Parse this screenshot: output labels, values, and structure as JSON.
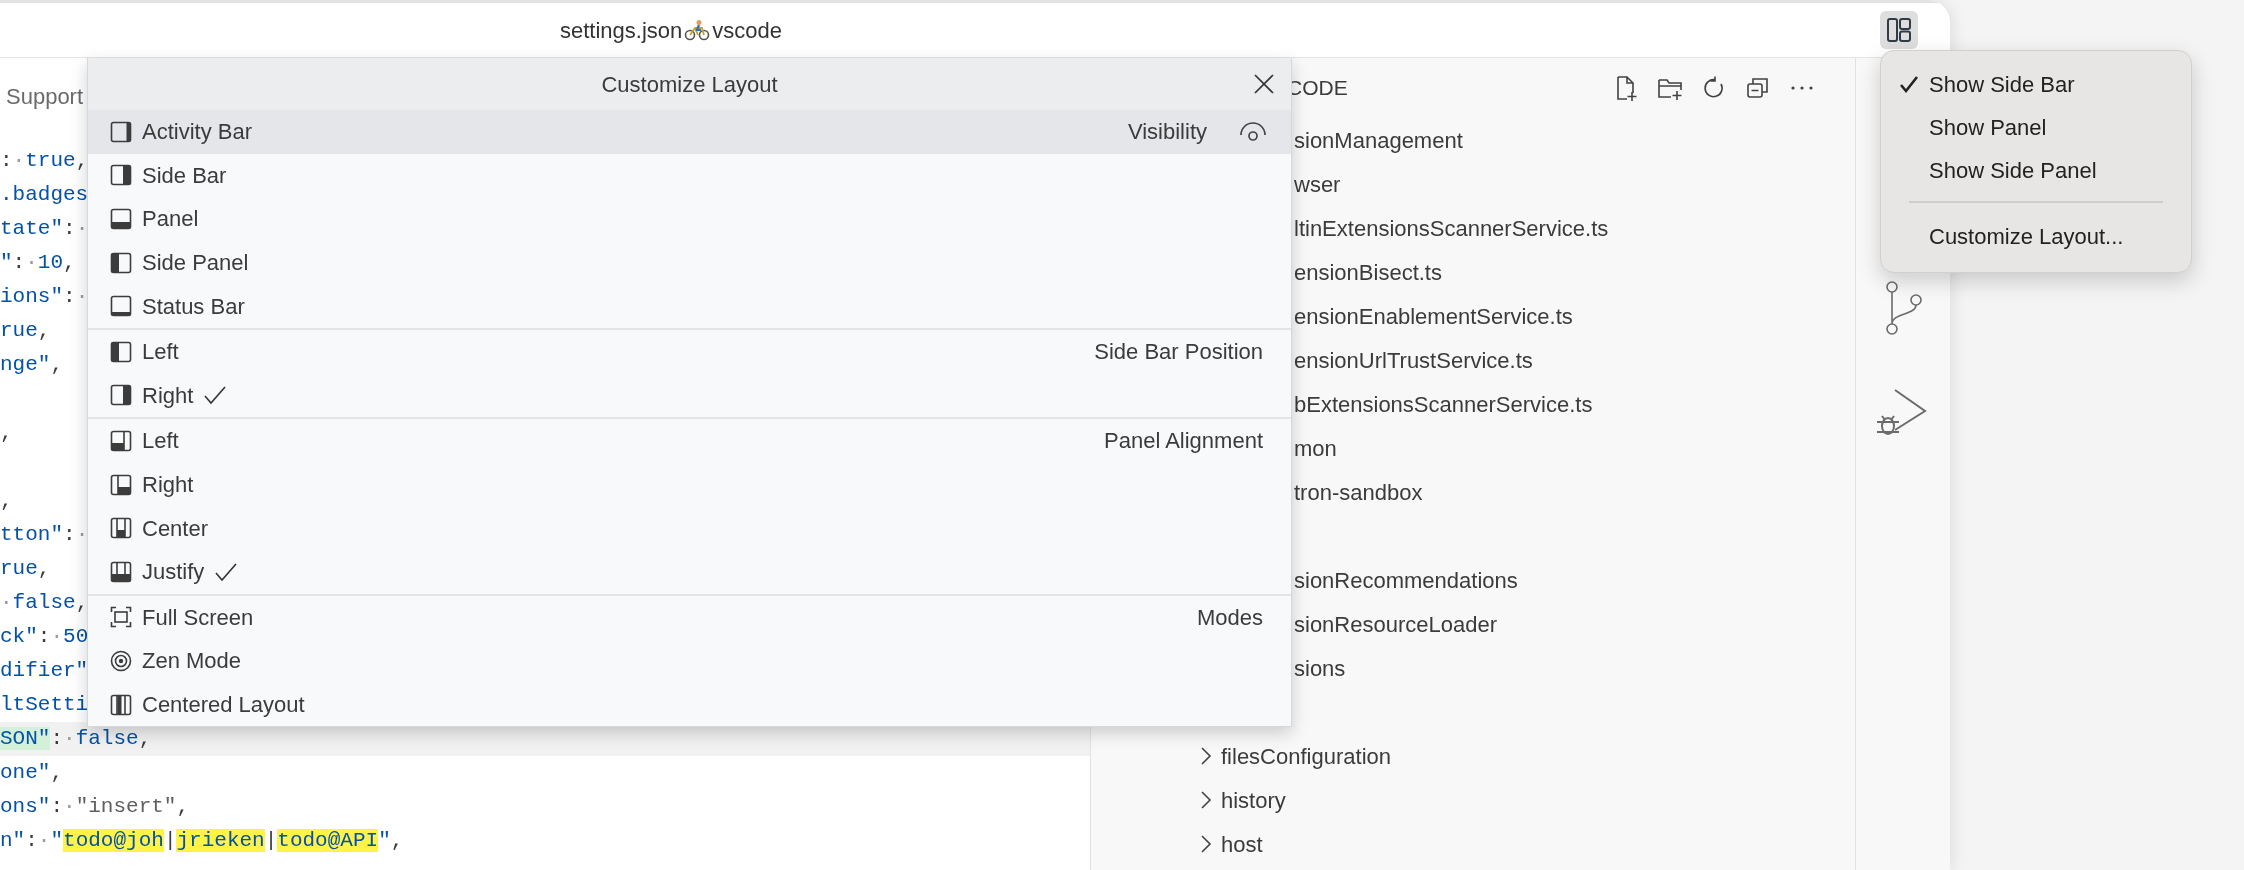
{
  "title_bar": {
    "file": "settings.json",
    "folder": "vscode"
  },
  "editor": {
    "tab": "Support",
    "lines": [
      {
        "current": false,
        "tokens": [
          {
            "kind": "punct",
            "text": ":"
          },
          {
            "kind": "ws",
            "text": "·"
          },
          {
            "kind": "lit",
            "text": "true"
          },
          {
            "kind": "punct",
            "text": ","
          }
        ]
      },
      {
        "current": false,
        "tokens": [
          {
            "kind": "key",
            "text": ".badges"
          }
        ]
      },
      {
        "current": false,
        "tokens": [
          {
            "kind": "key",
            "text": "tate\""
          },
          {
            "kind": "punct",
            "text": ":"
          },
          {
            "kind": "ws",
            "text": "·"
          }
        ]
      },
      {
        "current": false,
        "tokens": [
          {
            "kind": "key",
            "text": "\""
          },
          {
            "kind": "punct",
            "text": ":"
          },
          {
            "kind": "ws",
            "text": "·"
          },
          {
            "kind": "lit",
            "text": "10"
          },
          {
            "kind": "punct",
            "text": ","
          }
        ]
      },
      {
        "current": false,
        "tokens": [
          {
            "kind": "key",
            "text": "ions\""
          },
          {
            "kind": "punct",
            "text": ":"
          },
          {
            "kind": "ws",
            "text": "·"
          }
        ]
      },
      {
        "current": false,
        "tokens": [
          {
            "kind": "lit",
            "text": "rue"
          },
          {
            "kind": "punct",
            "text": ","
          }
        ]
      },
      {
        "current": false,
        "tokens": [
          {
            "kind": "lit",
            "text": "nge\""
          },
          {
            "kind": "punct",
            "text": ","
          }
        ]
      },
      {
        "current": false
      },
      {
        "current": false,
        "tokens": [
          {
            "kind": "punct",
            "text": ","
          }
        ]
      },
      {
        "current": false
      },
      {
        "current": false,
        "tokens": [
          {
            "kind": "punct",
            "text": ","
          }
        ]
      },
      {
        "current": false,
        "tokens": [
          {
            "kind": "key",
            "text": "tton\""
          },
          {
            "kind": "punct",
            "text": ":"
          },
          {
            "kind": "ws",
            "text": "·"
          }
        ]
      },
      {
        "current": false,
        "tokens": [
          {
            "kind": "lit",
            "text": "rue"
          },
          {
            "kind": "punct",
            "text": ","
          }
        ]
      },
      {
        "current": false,
        "tokens": [
          {
            "kind": "ws",
            "text": "·"
          },
          {
            "kind": "lit",
            "text": "false"
          },
          {
            "kind": "punct",
            "text": ","
          }
        ]
      },
      {
        "current": false,
        "tokens": [
          {
            "kind": "key",
            "text": "ck\""
          },
          {
            "kind": "punct",
            "text": ":"
          },
          {
            "kind": "ws",
            "text": "·"
          },
          {
            "kind": "lit",
            "text": "50"
          }
        ]
      },
      {
        "current": false,
        "tokens": [
          {
            "kind": "key",
            "text": "difier\""
          }
        ]
      },
      {
        "current": false,
        "tokens": [
          {
            "kind": "key",
            "text": "ltSetti"
          }
        ]
      },
      {
        "current": true,
        "tokens": [
          {
            "kind": "match",
            "text": "SON\""
          },
          {
            "kind": "punct",
            "text": ":"
          },
          {
            "kind": "ws",
            "text": "·"
          },
          {
            "kind": "lit",
            "text": "false"
          },
          {
            "kind": "punct",
            "text": ","
          }
        ]
      },
      {
        "current": false,
        "tokens": [
          {
            "kind": "lit",
            "text": "one\""
          },
          {
            "kind": "punct",
            "text": ","
          }
        ]
      },
      {
        "current": false,
        "tokens": [
          {
            "kind": "key",
            "text": "ons\""
          },
          {
            "kind": "punct",
            "text": ":"
          },
          {
            "kind": "ws",
            "text": "·"
          },
          {
            "kind": "str",
            "text": "\"insert\""
          },
          {
            "kind": "punct",
            "text": ","
          }
        ]
      },
      {
        "current": false,
        "tokens": [
          {
            "kind": "key",
            "text": "n\""
          },
          {
            "kind": "punct",
            "text": ":"
          },
          {
            "kind": "ws",
            "text": "·"
          },
          {
            "kind": "lit",
            "text": "\""
          },
          {
            "kind": "hl",
            "text": "todo@joh"
          },
          {
            "kind": "punct",
            "text": "|"
          },
          {
            "kind": "hl",
            "text": "jrieken"
          },
          {
            "kind": "punct",
            "text": "|"
          },
          {
            "kind": "hl",
            "text": "todo@API"
          },
          {
            "kind": "lit",
            "text": "\""
          },
          {
            "kind": "punct",
            "text": ","
          }
        ]
      }
    ]
  },
  "explorer": {
    "title": "CODE",
    "items": [
      {
        "kind": "cut",
        "label": "sionManagement"
      },
      {
        "kind": "cut",
        "label": "wser"
      },
      {
        "kind": "cut",
        "label": "ltinExtensionsScannerService.ts"
      },
      {
        "kind": "cut",
        "label": "ensionBisect.ts"
      },
      {
        "kind": "cut",
        "label": "ensionEnablementService.ts"
      },
      {
        "kind": "cut",
        "label": "ensionUrlTrustService.ts"
      },
      {
        "kind": "cut",
        "label": "bExtensionsScannerService.ts"
      },
      {
        "kind": "cut",
        "label": "mon"
      },
      {
        "kind": "cut",
        "label": "tron-sandbox"
      },
      {
        "kind": "covered"
      },
      {
        "kind": "cut",
        "label": "sionRecommendations"
      },
      {
        "kind": "cut",
        "label": "sionResourceLoader"
      },
      {
        "kind": "cut",
        "label": "sions"
      },
      {
        "kind": "covered"
      },
      {
        "kind": "folder",
        "label": "filesConfiguration",
        "expanded": false
      },
      {
        "kind": "folder",
        "label": "history",
        "expanded": false
      },
      {
        "kind": "folder",
        "label": "host",
        "expanded": false
      }
    ]
  },
  "customize_layout": {
    "title": "Customize Layout",
    "groups": [
      {
        "label": "Visibility",
        "items": [
          {
            "label": "Activity Bar",
            "selected": true
          },
          {
            "label": "Side Bar",
            "selected": false
          },
          {
            "label": "Panel",
            "selected": false
          },
          {
            "label": "Side Panel",
            "selected": false
          },
          {
            "label": "Status Bar",
            "selected": false
          }
        ]
      },
      {
        "label": "Side Bar Position",
        "items": [
          {
            "label": "Left",
            "selected": false,
            "checked": false
          },
          {
            "label": "Right",
            "selected": false,
            "checked": true
          }
        ]
      },
      {
        "label": "Panel Alignment",
        "items": [
          {
            "label": "Left",
            "selected": false,
            "checked": false
          },
          {
            "label": "Right",
            "selected": false,
            "checked": false
          },
          {
            "label": "Center",
            "selected": false,
            "checked": false
          },
          {
            "label": "Justify",
            "selected": false,
            "checked": true
          }
        ]
      },
      {
        "label": "Modes",
        "items": [
          {
            "label": "Full Screen",
            "selected": false
          },
          {
            "label": "Zen Mode",
            "selected": false
          },
          {
            "label": "Centered Layout",
            "selected": false
          }
        ]
      }
    ]
  },
  "layout_menu": {
    "groups": [
      {
        "items": [
          {
            "label": "Show Side Bar",
            "checked": true
          },
          {
            "label": "Show Panel",
            "checked": false
          },
          {
            "label": "Show Side Panel",
            "checked": false
          }
        ]
      },
      {
        "items": [
          {
            "label": "Customize Layout...",
            "checked": false
          }
        ]
      }
    ]
  }
}
